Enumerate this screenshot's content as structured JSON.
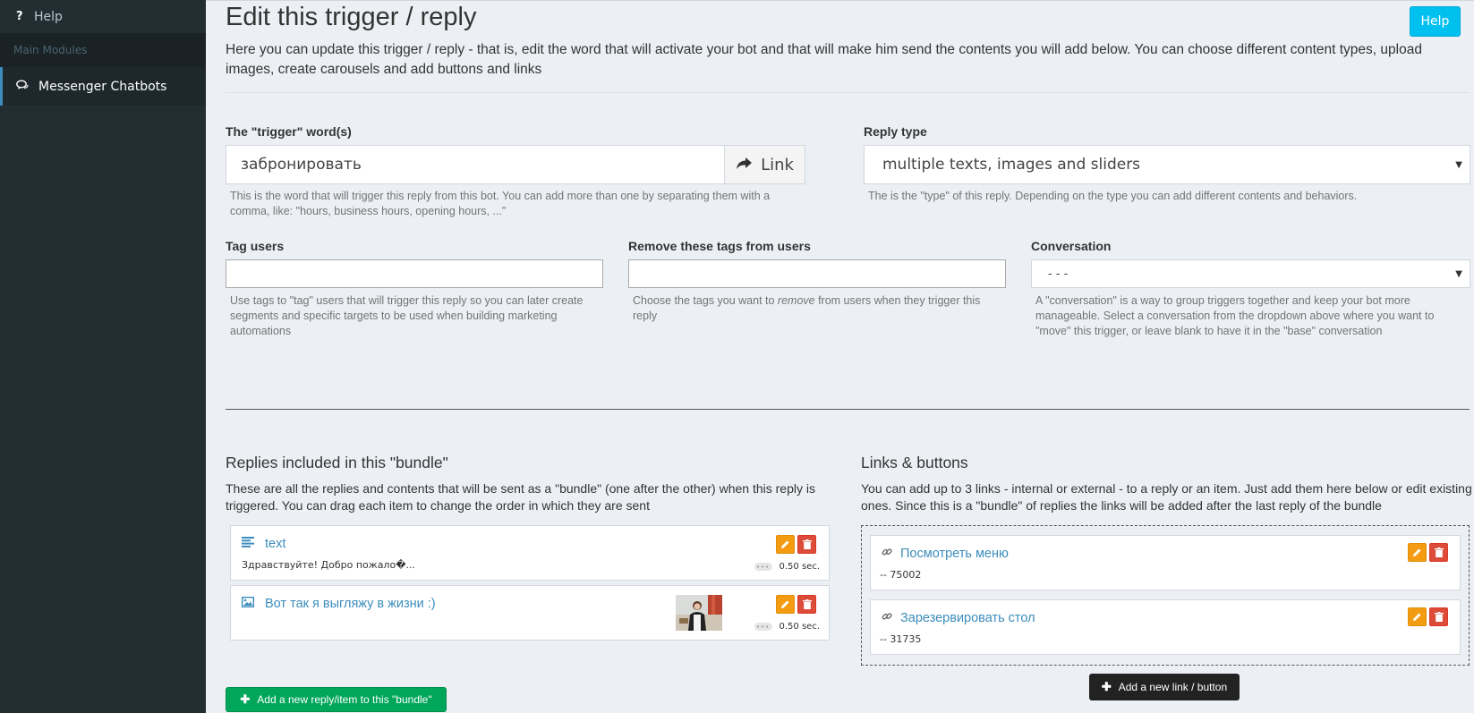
{
  "sidebar": {
    "help_icon": "?",
    "help_label": "Help",
    "section_header": "Main Modules",
    "active_item_icon": "comments-icon",
    "active_item_label": "Messenger Chatbots"
  },
  "header": {
    "title": "Edit this trigger / reply",
    "help_button": "Help",
    "intro": "Here you can update this trigger / reply - that is, edit the word that will activate your bot and that will make him send the contents you will add below. You can choose different content types, upload images, create carousels and add buttons and links"
  },
  "form": {
    "trigger": {
      "label": "The \"trigger\" word(s)",
      "value": "забронировать",
      "addon_label": "Link",
      "hint": "This is the word that will trigger this reply from this bot. You can add more than one by separating them with a comma, like: \"hours, business hours, opening hours, ...\""
    },
    "reply_type": {
      "label": "Reply type",
      "value": "multiple texts, images and sliders",
      "hint": "The is the \"type\" of this reply. Depending on the type you can add different contents and behaviors."
    },
    "tag_users": {
      "label": "Tag users",
      "value": "",
      "hint": "Use tags to \"tag\" users that will trigger this reply so you can later create segments and specific targets to be used when building marketing automations"
    },
    "remove_tags": {
      "label": "Remove these tags from users",
      "value": "",
      "hint_before": "Choose the tags you want to ",
      "hint_em": "remove",
      "hint_after": " from users when they trigger this reply"
    },
    "conversation": {
      "label": "Conversation",
      "value": "- - -",
      "hint": "A \"conversation\" is a way to group triggers together and keep your bot more manageable. Select a conversation from the dropdown above where you want to \"move\" this trigger, or leave blank to have it in the \"base\" conversation"
    }
  },
  "bundle": {
    "title": "Replies included in this \"bundle\"",
    "description": "These are all the replies and contents that will be sent as a \"bundle\" (one after the other) when this reply is triggered. You can drag each item to change the order in which they are sent",
    "items": [
      {
        "icon": "align-left-icon",
        "title": "text",
        "preview": "Здравствуйте! Добро пожало�...",
        "delay": "0.50 sec."
      },
      {
        "icon": "image-icon",
        "title": "Вот так я выгляжу в жизни :)",
        "preview": "",
        "delay": "0.50 sec."
      }
    ],
    "add_button": "Add a new reply/item to this \"bundle\""
  },
  "links": {
    "title": "Links & buttons",
    "description": "You can add up to 3 links - internal or external - to a reply or an item. Just add them here below or edit existing ones. Since this is a \"bundle\" of replies the links will be added after the last reply of the bundle",
    "items": [
      {
        "icon": "link-icon",
        "title": "Посмотреть меню",
        "sub": "-- 75002"
      },
      {
        "icon": "link-icon",
        "title": "Зарезервировать стол",
        "sub": "-- 31735"
      }
    ],
    "add_button": "Add a new link / button"
  },
  "colors": {
    "sidebar_bg": "#222d32",
    "accent_blue": "#3c8dbc",
    "help_btn": "#00c0ef",
    "edit_btn": "#f39c12",
    "delete_btn": "#dd4b39",
    "add_green": "#00a65a"
  }
}
